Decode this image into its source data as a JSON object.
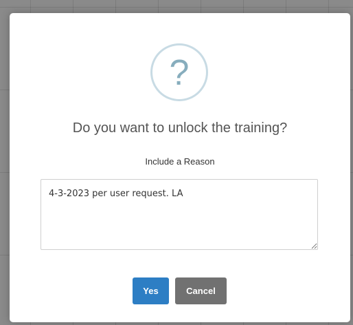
{
  "dialog": {
    "icon": "question-mark-icon",
    "icon_glyph": "?",
    "title": "Do you want to unlock the training?",
    "reason_label": "Include a Reason",
    "reason_value": "4-3-2023 per user request. LA",
    "confirm_label": "Yes",
    "cancel_label": "Cancel"
  },
  "colors": {
    "overlay": "#8a8a8a",
    "confirm_button": "#2d7ec4",
    "cancel_button": "#717171",
    "icon_ring": "#c8dbe4",
    "icon_glyph": "#87adbd"
  }
}
